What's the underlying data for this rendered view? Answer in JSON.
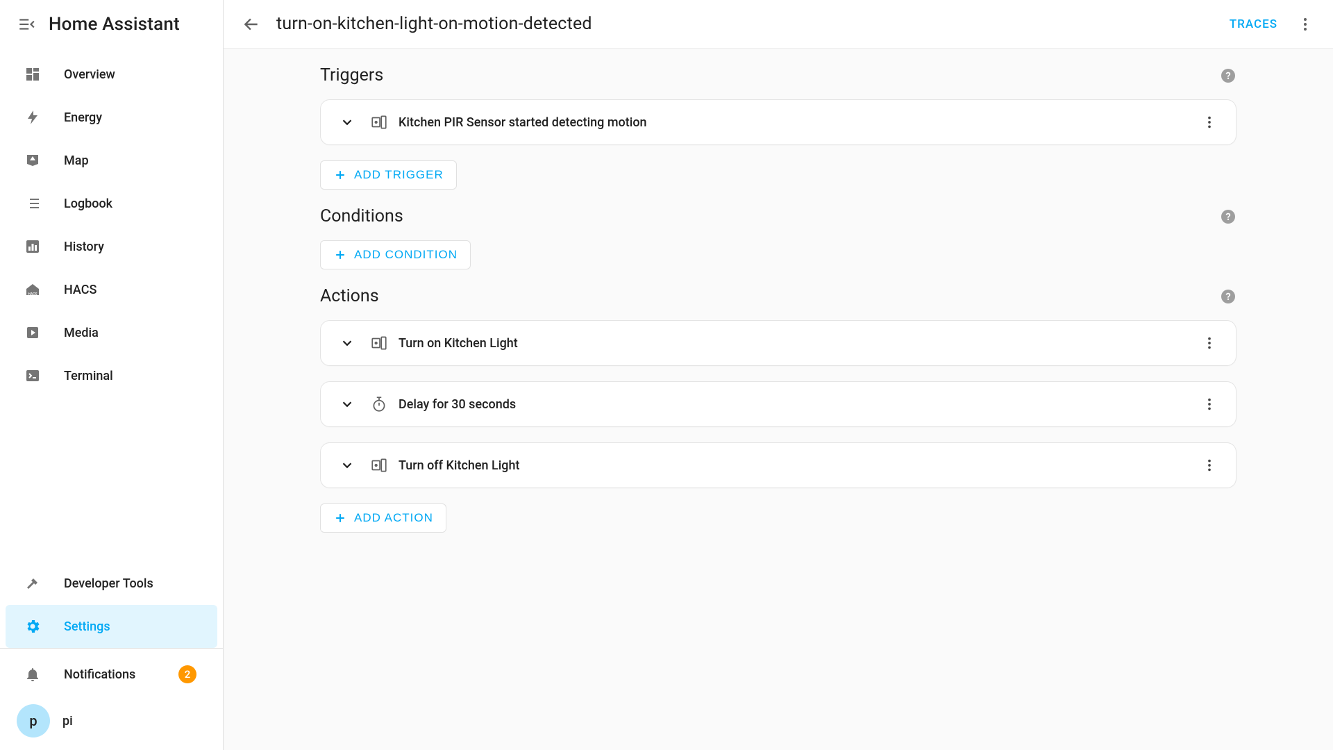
{
  "app": {
    "title": "Home Assistant"
  },
  "sidebar": {
    "nav": [
      {
        "id": "overview",
        "label": "Overview",
        "icon": "dashboard-icon"
      },
      {
        "id": "energy",
        "label": "Energy",
        "icon": "bolt-icon"
      },
      {
        "id": "map",
        "label": "Map",
        "icon": "map-icon"
      },
      {
        "id": "logbook",
        "label": "Logbook",
        "icon": "list-icon"
      },
      {
        "id": "history",
        "label": "History",
        "icon": "chart-icon"
      },
      {
        "id": "hacs",
        "label": "HACS",
        "icon": "hacs-icon"
      },
      {
        "id": "media",
        "label": "Media",
        "icon": "media-icon"
      },
      {
        "id": "terminal",
        "label": "Terminal",
        "icon": "terminal-icon"
      }
    ],
    "dev_tools_label": "Developer Tools",
    "settings_label": "Settings",
    "notifications": {
      "label": "Notifications",
      "count": 2
    },
    "user": {
      "initial": "p",
      "name": "pi"
    }
  },
  "header": {
    "title": "turn-on-kitchen-light-on-motion-detected",
    "traces_label": "TRACES"
  },
  "sections": {
    "triggers": {
      "title": "Triggers",
      "items": [
        {
          "icon": "motion-icon",
          "label": "Kitchen PIR Sensor started detecting motion"
        }
      ],
      "add_label": "ADD TRIGGER"
    },
    "conditions": {
      "title": "Conditions",
      "items": [],
      "add_label": "ADD CONDITION"
    },
    "actions": {
      "title": "Actions",
      "items": [
        {
          "icon": "device-icon",
          "label": "Turn on Kitchen Light"
        },
        {
          "icon": "timer-icon",
          "label": "Delay for 30 seconds"
        },
        {
          "icon": "device-icon",
          "label": "Turn off Kitchen Light"
        }
      ],
      "add_label": "ADD ACTION"
    }
  }
}
